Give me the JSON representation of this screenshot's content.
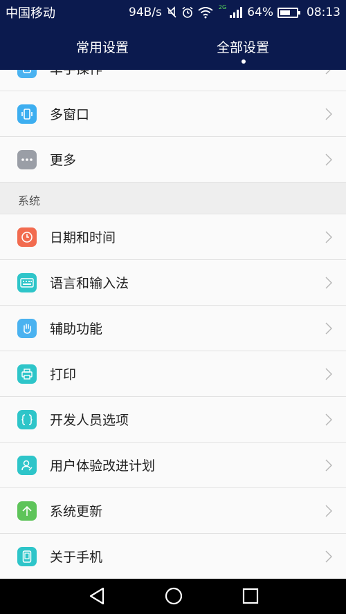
{
  "status_bar": {
    "carrier": "中国移动",
    "speed": "94B/s",
    "network_badge": "2G",
    "battery": "64%",
    "battery_level": 0.64,
    "time": "08:13"
  },
  "tabs": [
    {
      "label": "常用设置",
      "active": false
    },
    {
      "label": "全部设置",
      "active": true
    }
  ],
  "list": {
    "partial_item": {
      "label": "单手操作",
      "icon": "one-hand-icon"
    },
    "items_top": [
      {
        "label": "多窗口",
        "icon": "multi-window-icon",
        "color": "#3daef0"
      },
      {
        "label": "更多",
        "icon": "more-icon",
        "color": "#9a9ea6"
      }
    ],
    "section_title": "系统",
    "items_system": [
      {
        "label": "日期和时间",
        "icon": "clock-icon",
        "color": "#f26b4f"
      },
      {
        "label": "语言和输入法",
        "icon": "keyboard-icon",
        "color": "#2ec5c9"
      },
      {
        "label": "辅助功能",
        "icon": "hand-icon",
        "color": "#4ab2f0"
      },
      {
        "label": "打印",
        "icon": "printer-icon",
        "color": "#2ec5c9"
      },
      {
        "label": "开发人员选项",
        "icon": "braces-icon",
        "color": "#2ec5c9"
      },
      {
        "label": "用户体验改进计划",
        "icon": "user-icon",
        "color": "#2ec5c9"
      },
      {
        "label": "系统更新",
        "icon": "arrow-up-icon",
        "color": "#5ec45a"
      },
      {
        "label": "关于手机",
        "icon": "phone-icon",
        "color": "#2ec5c9"
      }
    ]
  },
  "nav_bar": {
    "back": "back-icon",
    "home": "home-icon",
    "recents": "recents-icon"
  }
}
